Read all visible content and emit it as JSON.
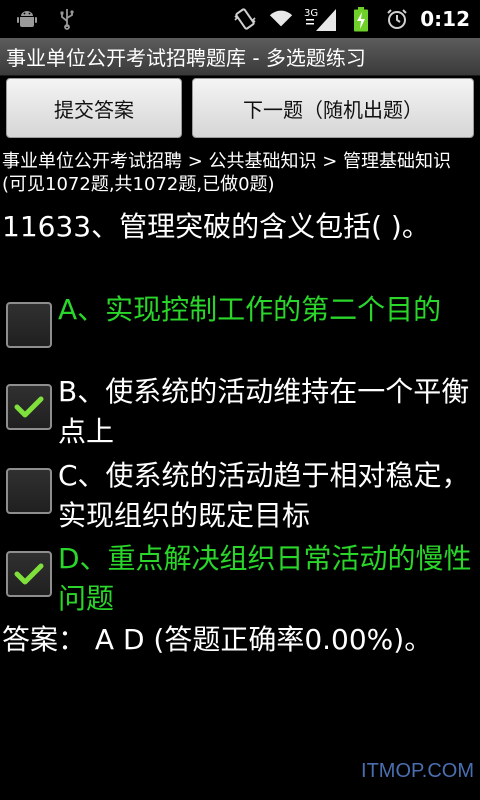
{
  "status_bar": {
    "icons": [
      "android-debug-icon",
      "usb-icon",
      "vibrate-icon",
      "wifi-icon",
      "3g-signal-icon",
      "battery-charging-icon",
      "alarm-icon"
    ],
    "network_label": "3G",
    "time": "0:12"
  },
  "app": {
    "title": "事业单位公开考试招聘题库 - 多选题练习"
  },
  "buttons": {
    "submit": "提交答案",
    "next": "下一题（随机出题）"
  },
  "breadcrumb": "事业单位公开考试招聘 > 公共基础知识 > 管理基础知识 (可见1072题,共1072题,已做0题)",
  "question": "11633、管理突破的含义包括( )。",
  "options": [
    {
      "text": "A、实现控制工作的第二个目的",
      "checked": false,
      "color": "#2ad62a"
    },
    {
      "text": "B、使系统的活动维持在一个平衡点上",
      "checked": true,
      "color": "#ffffff"
    },
    {
      "text": "C、使系统的活动趋于相对稳定，实现组织的既定目标",
      "checked": false,
      "color": "#ffffff"
    },
    {
      "text": "D、重点解决组织日常活动的慢性问题",
      "checked": true,
      "color": "#2ad62a"
    }
  ],
  "answer": "答案： A D (答题正确率0.00%)。",
  "watermark": "ITMOP.COM",
  "colors": {
    "correct": "#2ad62a",
    "check": "#7fe03c",
    "background": "#000000"
  }
}
